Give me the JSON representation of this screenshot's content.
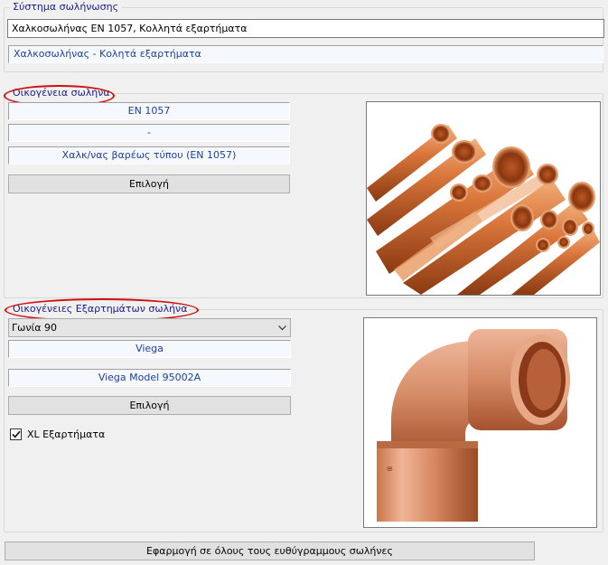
{
  "system": {
    "title": "Σύστημα σωλήνωσης",
    "value": "Χαλκοσωλήνας EN 1057, Κολλητά εξαρτήματα",
    "description": "Χαλκοσωλήνας - Κολητά εξαρτήματα"
  },
  "pipe_family": {
    "title": "Οικογένεια σωλήνα",
    "standard": "EN 1057",
    "sub": "-",
    "name": "Χαλκ/νας βαρέως τύπου (EN 1057)",
    "select_label": "Επιλογή",
    "image_icon": "copper-pipes-image"
  },
  "fitting_family": {
    "title": "Οικογένειες Εξαρτημάτων σωλήνα",
    "selected_type": "Γωνία 90",
    "manufacturer": "Viega",
    "model": "Viega Model 95002A",
    "select_label": "Επιλογή",
    "xl_label": "XL Εξαρτήματα",
    "xl_checked": true,
    "image_icon": "copper-elbow-image"
  },
  "apply_all_label": "Εφαρμογή σε όλους τους ευθύγραμμους σωλήνες",
  "colors": {
    "accent_text": "#1f3f9a",
    "group_title": "#1a1a8c",
    "highlight": "#d01010"
  }
}
